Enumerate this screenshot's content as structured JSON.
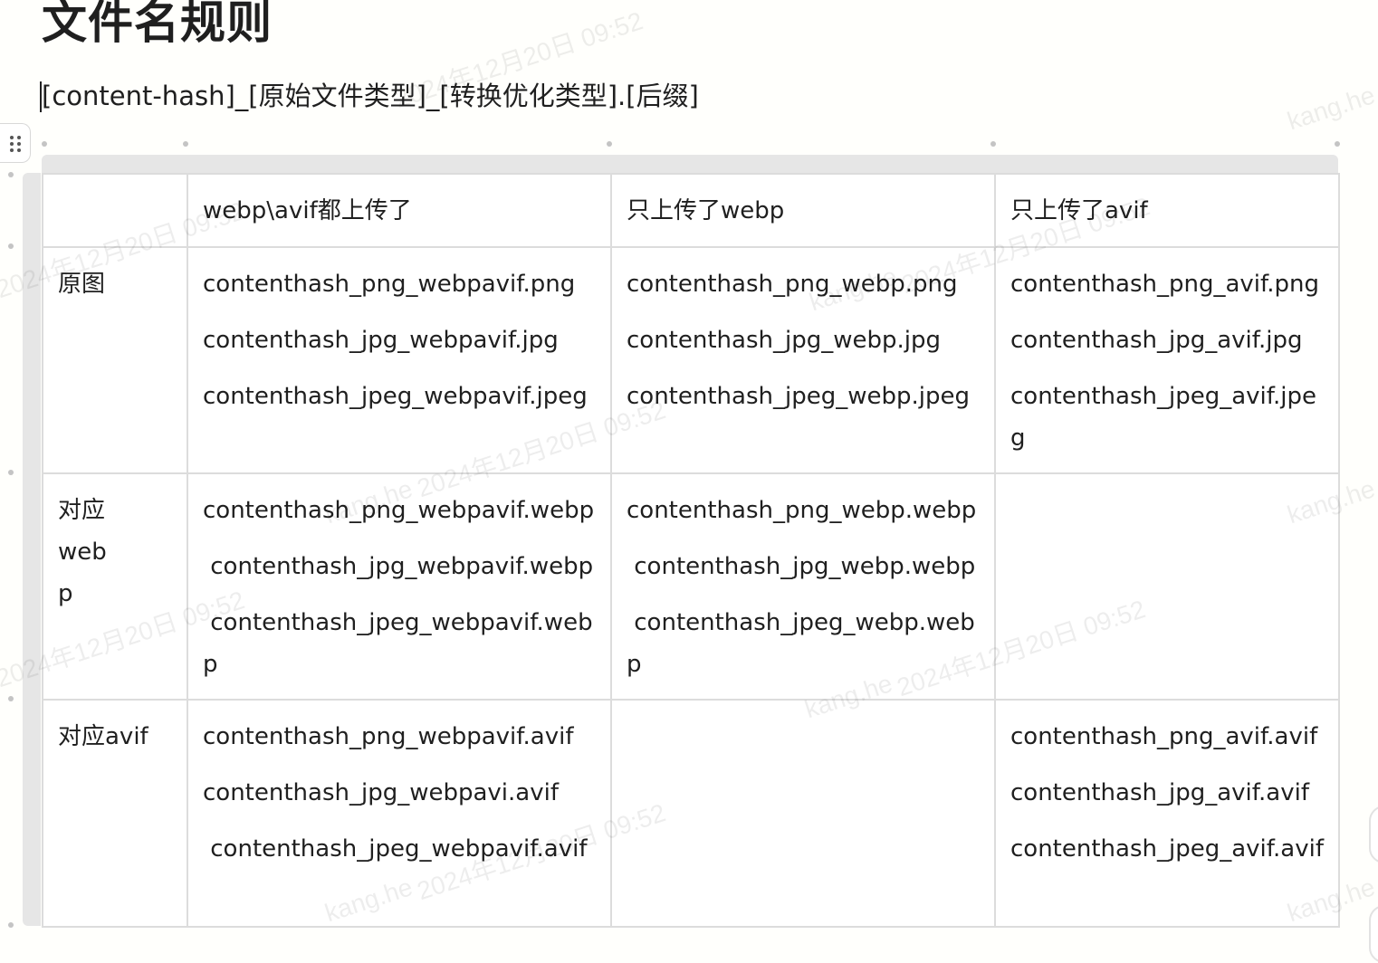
{
  "page": {
    "title": "文件名规则",
    "rule": "[content-hash]_[原始文件类型]_[转换优化类型].[后缀]"
  },
  "table": {
    "header": [
      "",
      "webp\\avif都上传了",
      "只上传了webp",
      "只上传了avif"
    ],
    "rows": [
      {
        "label": "原图",
        "cells": [
          [
            "contenthash_png_webpavif.png",
            "contenthash_jpg_webpavif.jpg",
            "contenthash_jpeg_webpavif.jpeg"
          ],
          [
            "contenthash_png_webp.png",
            "contenthash_jpg_webp.jpg",
            "contenthash_jpeg_webp.jpeg"
          ],
          [
            "contenthash_png_avif.png",
            "contenthash_jpg_avif.jpg",
            "contenthash_jpeg_avif.jpeg"
          ]
        ]
      },
      {
        "label": "对应webp",
        "cells": [
          [
            "contenthash_png_webpavif.webp",
            " contenthash_jpg_webpavif.webp",
            " contenthash_jpeg_webpavif.webp"
          ],
          [
            "contenthash_png_webp.webp",
            " contenthash_jpg_webp.webp",
            " contenthash_jpeg_webp.webp"
          ],
          []
        ]
      },
      {
        "label": "对应avif",
        "cells": [
          [
            "contenthash_png_webpavif.avif",
            "contenthash_jpg_webpavi.avif",
            " contenthash_jpeg_webpavif.avif"
          ],
          [],
          [
            "contenthash_png_avif.avif",
            "contenthash_jpg_avif.avif",
            "contenthash_jpeg_avif.avif"
          ]
        ]
      }
    ]
  },
  "watermark": {
    "user": "kang.he",
    "timestamp": "2024年12月20日 09:52"
  }
}
